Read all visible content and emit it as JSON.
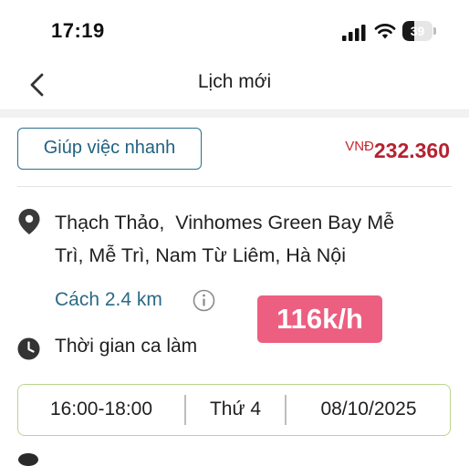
{
  "status_bar": {
    "time": "17:19",
    "battery_level": "39",
    "icons": [
      "signal-icon",
      "wifi-icon",
      "battery-icon"
    ]
  },
  "header": {
    "title": "Lịch mới",
    "back_icon": "chevron-left-icon"
  },
  "job": {
    "service_tag": "Giúp việc nhanh",
    "price_currency": "VNĐ",
    "price_amount": "232.360",
    "address": "Thạch Thảo,  Vinhomes Green Bay Mễ\nTrì, Mễ Trì, Nam Từ Liêm, Hà Nội",
    "distance": "Cách 2.4 km",
    "hourly_rate": "116k/h",
    "shift_label": "Thời gian ca làm",
    "schedule": {
      "time_range": "16:00-18:00",
      "weekday": "Thứ 4",
      "date": "08/10/2025"
    }
  },
  "colors": {
    "accent_teal": "#2b6f8c",
    "price_red": "#b42330",
    "rate_badge_pink": "#ec5f80",
    "schedule_border_green": "#b9d58c"
  }
}
